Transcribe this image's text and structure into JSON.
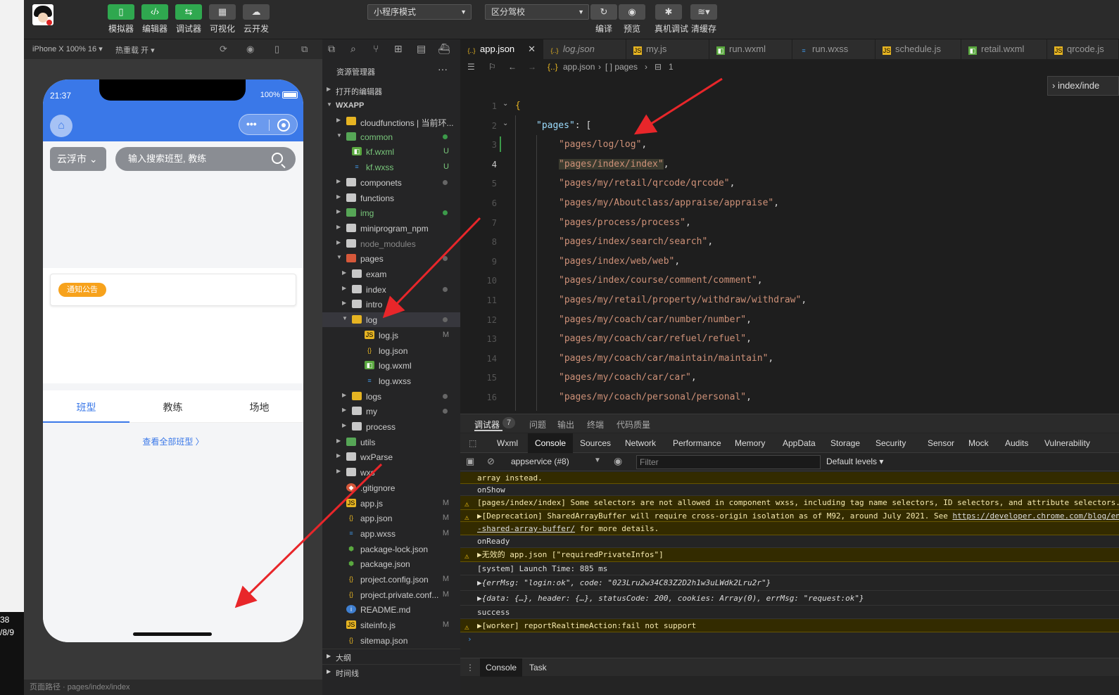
{
  "left_strip": {
    "clock_time": "38",
    "clock_date": "/8/9"
  },
  "toolbar": {
    "buttons": [
      {
        "label": "模拟器",
        "icon": "phone-icon"
      },
      {
        "label": "编辑器",
        "icon": "code-icon"
      },
      {
        "label": "调试器",
        "icon": "debug-icon"
      },
      {
        "label": "可视化",
        "icon": "layout-icon"
      },
      {
        "label": "云开发",
        "icon": "cloud-icon"
      }
    ],
    "mode_select": "小程序模式",
    "compile_select": "区分驾校",
    "actions": [
      "编译",
      "预览",
      "真机调试",
      "清缓存"
    ]
  },
  "simulator": {
    "device": "iPhone X 100% 16",
    "hot_reload": "热重载 开",
    "footer": "页面路径 · pages/index/index",
    "phone": {
      "time": "21:37",
      "battery": "100%",
      "city": "云浮市",
      "search_placeholder": "输入搜索班型, 教练",
      "notice_tag": "通知公告",
      "tabs": [
        "班型",
        "教练",
        "场地"
      ],
      "more_link": "查看全部班型 〉",
      "colors": {
        "header": "#3a78e8",
        "tag": "#f7a21c"
      }
    }
  },
  "explorer": {
    "title": "资源管理器",
    "open_editors": "打开的编辑器",
    "root": "WXAPP",
    "tree": [
      {
        "name": "cloudfunctions | 当前环...",
        "type": "folder-y",
        "depth": 1,
        "arrow": "▶",
        "status": ""
      },
      {
        "name": "common",
        "type": "folder-g",
        "depth": 1,
        "arrow": "▼",
        "status": "dot-g",
        "color": "#79c77b"
      },
      {
        "name": "kf.wxml",
        "type": "wxml",
        "depth": 2,
        "arrow": "",
        "status": "U",
        "color": "#79c77b"
      },
      {
        "name": "kf.wxss",
        "type": "wxss",
        "depth": 2,
        "arrow": "",
        "status": "U",
        "color": "#79c77b"
      },
      {
        "name": "componets",
        "type": "folder",
        "depth": 1,
        "arrow": "▶",
        "status": "dot"
      },
      {
        "name": "functions",
        "type": "folder",
        "depth": 1,
        "arrow": "▶",
        "status": ""
      },
      {
        "name": "img",
        "type": "folder-g",
        "depth": 1,
        "arrow": "▶",
        "status": "dot-g",
        "color": "#79c77b"
      },
      {
        "name": "miniprogram_npm",
        "type": "folder",
        "depth": 1,
        "arrow": "▶",
        "status": ""
      },
      {
        "name": "node_modules",
        "type": "folder",
        "depth": 1,
        "arrow": "▶",
        "status": "",
        "color": "#888"
      },
      {
        "name": "pages",
        "type": "folder-r",
        "depth": 1,
        "arrow": "▼",
        "status": "dot"
      },
      {
        "name": "exam",
        "type": "folder",
        "depth": 2,
        "arrow": "▶",
        "status": ""
      },
      {
        "name": "index",
        "type": "folder",
        "depth": 2,
        "arrow": "▶",
        "status": "dot"
      },
      {
        "name": "intro",
        "type": "folder",
        "depth": 2,
        "arrow": "▶",
        "status": ""
      },
      {
        "name": "log",
        "type": "folder-y",
        "depth": 2,
        "arrow": "▼",
        "status": "dot",
        "selected": true
      },
      {
        "name": "log.js",
        "type": "js",
        "depth": 3,
        "arrow": "",
        "status": "M"
      },
      {
        "name": "log.json",
        "type": "json",
        "depth": 3,
        "arrow": "",
        "status": ""
      },
      {
        "name": "log.wxml",
        "type": "wxml",
        "depth": 3,
        "arrow": "",
        "status": ""
      },
      {
        "name": "log.wxss",
        "type": "wxss",
        "depth": 3,
        "arrow": "",
        "status": ""
      },
      {
        "name": "logs",
        "type": "folder-y",
        "depth": 2,
        "arrow": "▶",
        "status": "dot"
      },
      {
        "name": "my",
        "type": "folder",
        "depth": 2,
        "arrow": "▶",
        "status": "dot"
      },
      {
        "name": "process",
        "type": "folder",
        "depth": 2,
        "arrow": "▶",
        "status": ""
      },
      {
        "name": "utils",
        "type": "folder-g",
        "depth": 1,
        "arrow": "▶",
        "status": ""
      },
      {
        "name": "wxParse",
        "type": "folder",
        "depth": 1,
        "arrow": "▶",
        "status": ""
      },
      {
        "name": "wxs",
        "type": "folder",
        "depth": 1,
        "arrow": "▶",
        "status": ""
      },
      {
        "name": ".gitignore",
        "type": "git",
        "depth": 1,
        "arrow": "",
        "status": ""
      },
      {
        "name": "app.js",
        "type": "js",
        "depth": 1,
        "arrow": "",
        "status": "M"
      },
      {
        "name": "app.json",
        "type": "json",
        "depth": 1,
        "arrow": "",
        "status": "M"
      },
      {
        "name": "app.wxss",
        "type": "wxss",
        "depth": 1,
        "arrow": "",
        "status": "M"
      },
      {
        "name": "package-lock.json",
        "type": "pkg",
        "depth": 1,
        "arrow": "",
        "status": ""
      },
      {
        "name": "package.json",
        "type": "pkg",
        "depth": 1,
        "arrow": "",
        "status": ""
      },
      {
        "name": "project.config.json",
        "type": "json",
        "depth": 1,
        "arrow": "",
        "status": "M"
      },
      {
        "name": "project.private.conf...",
        "type": "json",
        "depth": 1,
        "arrow": "",
        "status": "M"
      },
      {
        "name": "README.md",
        "type": "info",
        "depth": 1,
        "arrow": "",
        "status": ""
      },
      {
        "name": "siteinfo.js",
        "type": "js",
        "depth": 1,
        "arrow": "",
        "status": "M"
      },
      {
        "name": "sitemap.json",
        "type": "json",
        "depth": 1,
        "arrow": "",
        "status": ""
      }
    ],
    "sections": [
      "大纲",
      "时间线"
    ]
  },
  "editor": {
    "tabs": [
      {
        "name": "app.json",
        "icon": "{..}",
        "active": true
      },
      {
        "name": "log.json",
        "icon": "{..}",
        "italic": true
      },
      {
        "name": "my.js",
        "icon": "JS"
      },
      {
        "name": "run.wxml",
        "icon": "◧"
      },
      {
        "name": "run.wxss",
        "icon": "≡"
      },
      {
        "name": "schedule.js",
        "icon": "JS"
      },
      {
        "name": "retail.wxml",
        "icon": "◧"
      },
      {
        "name": "qrcode.js",
        "icon": "JS"
      }
    ],
    "breadcrumb": [
      "app.json",
      "[ ] pages",
      "1"
    ],
    "peek_label": "index/inde",
    "lines": [
      {
        "n": "1",
        "text": "{"
      },
      {
        "n": "2",
        "key": "\"pages\"",
        "rest": ": ["
      },
      {
        "n": "3",
        "str": "\"pages/log/log\""
      },
      {
        "n": "4",
        "str": "\"pages/index/index\""
      },
      {
        "n": "5",
        "str": "\"pages/my/retail/qrcode/qrcode\""
      },
      {
        "n": "6",
        "str": "\"pages/my/Aboutclass/appraise/appraise\""
      },
      {
        "n": "7",
        "str": "\"pages/process/process\""
      },
      {
        "n": "8",
        "str": "\"pages/index/search/search\""
      },
      {
        "n": "9",
        "str": "\"pages/index/web/web\""
      },
      {
        "n": "10",
        "str": "\"pages/index/course/comment/comment\""
      },
      {
        "n": "11",
        "str": "\"pages/my/retail/property/withdraw/withdraw\""
      },
      {
        "n": "12",
        "str": "\"pages/my/coach/car/number/number\""
      },
      {
        "n": "13",
        "str": "\"pages/my/coach/car/refuel/refuel\""
      },
      {
        "n": "14",
        "str": "\"pages/my/coach/car/maintain/maintain\""
      },
      {
        "n": "15",
        "str": "\"pages/my/coach/car/car\""
      },
      {
        "n": "16",
        "str": "\"pages/my/coach/personal/personal\""
      }
    ]
  },
  "devtools": {
    "top_tabs": [
      "调试器",
      "问题",
      "输出",
      "终端",
      "代码质量"
    ],
    "badge": "7",
    "panels": [
      "Wxml",
      "Console",
      "Sources",
      "Network",
      "Performance",
      "Memory",
      "AppData",
      "Storage",
      "Security",
      "Sensor",
      "Mock",
      "Audits",
      "Vulnerability"
    ],
    "context": "appservice (#8)",
    "filter_placeholder": "Filter",
    "levels": "Default levels ▾",
    "console": [
      {
        "type": "warn-cont",
        "text": "array instead."
      },
      {
        "type": "log",
        "text": "onShow"
      },
      {
        "type": "warn",
        "text": "[pages/index/index] Some selectors are not allowed in component wxss, including tag name selectors, ID selectors, and attribute selectors."
      },
      {
        "type": "warn",
        "text": "▶[Deprecation] SharedArrayBuffer will require cross-origin isolation as of M92, around July 2021. See ",
        "link": "https://developer.chrome.com/blog/enabling"
      },
      {
        "type": "warn-cont",
        "link": "-shared-array-buffer/",
        "text": " for more details."
      },
      {
        "type": "log",
        "text": "onReady"
      },
      {
        "type": "warn",
        "text": "▶无效的 app.json [\"requiredPrivateInfos\"]"
      },
      {
        "type": "log",
        "text": "[system] Launch Time: 885 ms"
      },
      {
        "type": "obj1",
        "text": "▶{errMsg: \"login:ok\", code: \"023Lru2w34C83Z2D2h1w3uLWdk2Lru2r\"}"
      },
      {
        "type": "obj2",
        "text": "▶{data: {…}, header: {…}, statusCode: 200, cookies: Array(0), errMsg: \"request:ok\"}"
      },
      {
        "type": "log",
        "text": "success"
      },
      {
        "type": "warn",
        "text": "▶[worker] reportRealtimeAction:fail not support"
      },
      {
        "type": "prompt",
        "text": "›"
      }
    ],
    "footer_tabs": [
      "Console",
      "Task"
    ]
  }
}
